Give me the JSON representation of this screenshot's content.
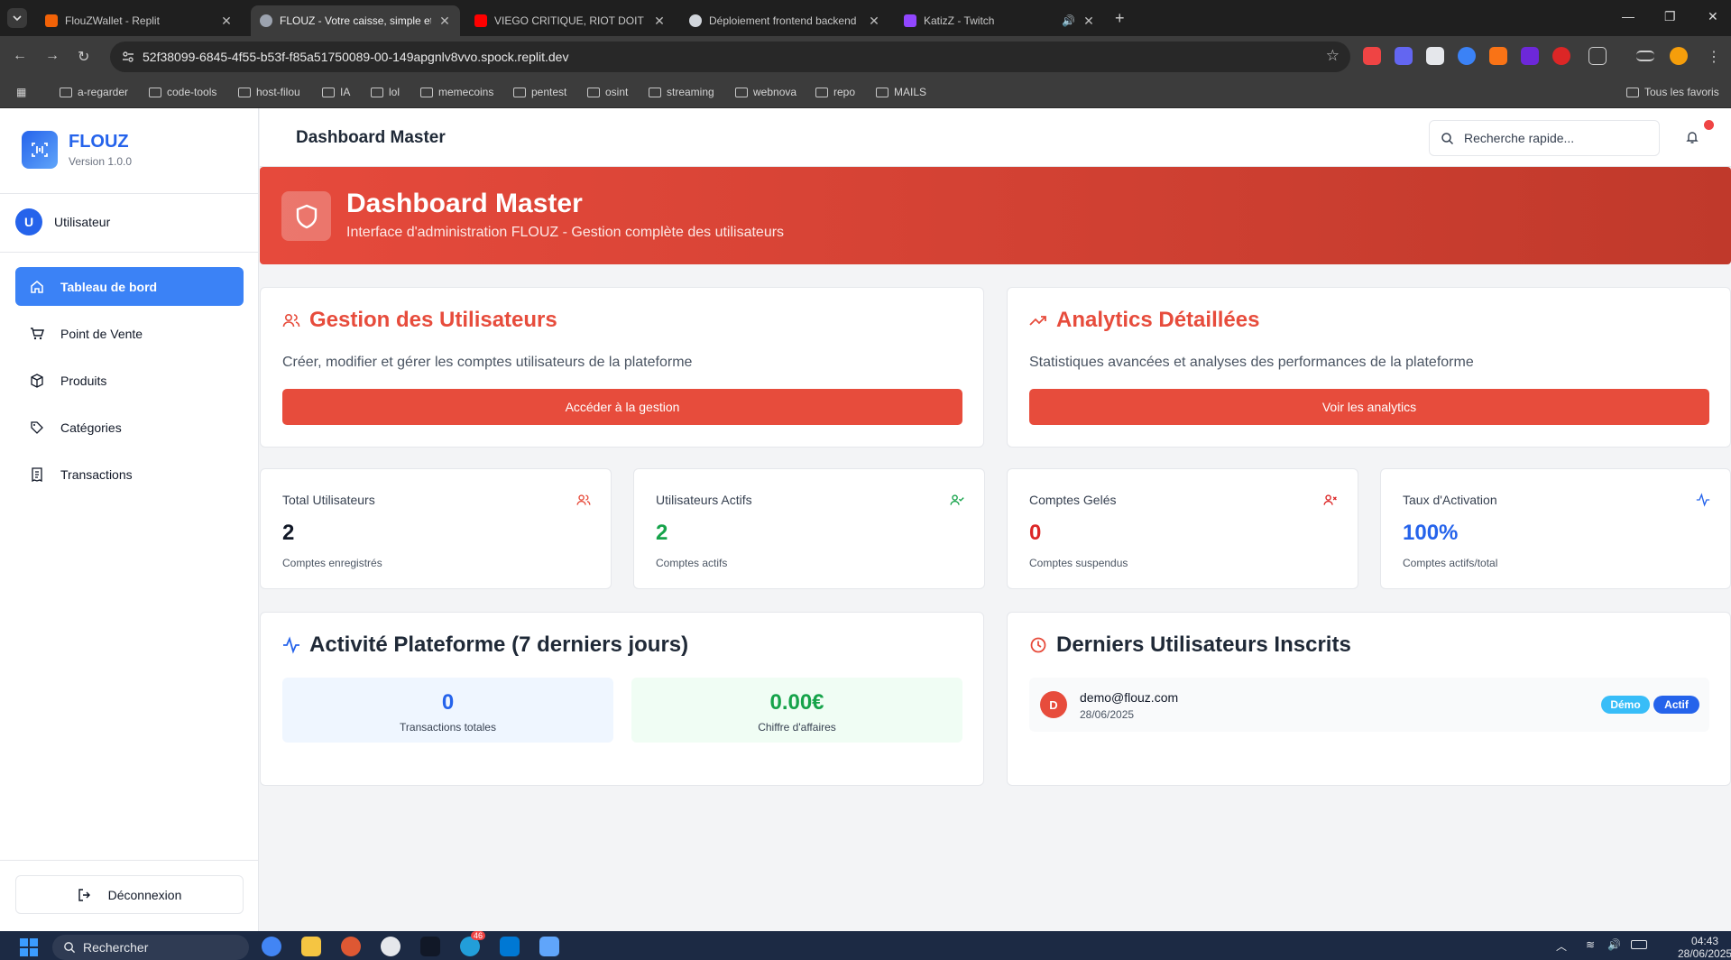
{
  "browser": {
    "tabs": [
      {
        "title": "FlouZWallet - Replit",
        "favicon_color": "#f26207"
      },
      {
        "title": "FLOUZ - Votre caisse, simple et",
        "favicon_color": "#9ca3af"
      },
      {
        "title": "VIEGO CRITIQUE, RIOT DOIT LE",
        "favicon_color": "#ff0000"
      },
      {
        "title": "Déploiement frontend backend",
        "favicon_color": "#d1d5db"
      },
      {
        "title": "KatizZ - Twitch",
        "favicon_color": "#9146ff"
      }
    ],
    "url": "52f38099-6845-4f55-b53f-f85a51750089-00-149apgnlv8vvo.spock.replit.dev",
    "bookmarks": [
      "a-regarder",
      "code-tools",
      "host-filou",
      "IA",
      "lol",
      "memecoins",
      "pentest",
      "osint",
      "streaming",
      "webnova",
      "repo",
      "MAILS"
    ],
    "all_bookmarks": "Tous les favoris"
  },
  "sidebar": {
    "brand": "FLOUZ",
    "version": "Version 1.0.0",
    "user_initial": "U",
    "user_name": "Utilisateur",
    "items": [
      {
        "label": "Tableau de bord",
        "icon": "home-icon"
      },
      {
        "label": "Point de Vente",
        "icon": "cart-icon"
      },
      {
        "label": "Produits",
        "icon": "package-icon"
      },
      {
        "label": "Catégories",
        "icon": "tag-icon"
      },
      {
        "label": "Transactions",
        "icon": "receipt-icon"
      }
    ],
    "logout": "Déconnexion"
  },
  "topbar": {
    "title": "Dashboard Master",
    "search_placeholder": "Recherche rapide..."
  },
  "hero": {
    "title": "Dashboard Master",
    "subtitle": "Interface d'administration FLOUZ - Gestion complète des utilisateurs"
  },
  "cards": {
    "users": {
      "title": "Gestion des Utilisateurs",
      "desc": "Créer, modifier et gérer les comptes utilisateurs de la plateforme",
      "button": "Accéder à la gestion"
    },
    "analytics": {
      "title": "Analytics Détaillées",
      "desc": "Statistiques avancées et analyses des performances de la plateforme",
      "button": "Voir les analytics"
    }
  },
  "stats": [
    {
      "label": "Total Utilisateurs",
      "value": "2",
      "sub": "Comptes enregistrés",
      "color": "#111827",
      "icon": "users-icon"
    },
    {
      "label": "Utilisateurs Actifs",
      "value": "2",
      "sub": "Comptes actifs",
      "color": "#16a34a",
      "icon": "user-check-icon"
    },
    {
      "label": "Comptes Gelés",
      "value": "0",
      "sub": "Comptes suspendus",
      "color": "#dc2626",
      "icon": "user-x-icon"
    },
    {
      "label": "Taux d'Activation",
      "value": "100%",
      "sub": "Comptes actifs/total",
      "color": "#2563eb",
      "icon": "activity-icon"
    }
  ],
  "activity": {
    "title": "Activité Plateforme (7 derniers jours)",
    "transactions_value": "0",
    "transactions_label": "Transactions totales",
    "revenue_value": "0.00€",
    "revenue_label": "Chiffre d'affaires"
  },
  "recent": {
    "title": "Derniers Utilisateurs Inscrits",
    "user_initial": "D",
    "email": "demo@flouz.com",
    "date": "28/06/2025",
    "badge_demo": "Démo",
    "badge_active": "Actif"
  },
  "taskbar": {
    "search": "Rechercher",
    "time": "04:43",
    "date": "28/06/2025",
    "telegram_badge": "46"
  },
  "colors": {
    "accent_red": "#e74c3c",
    "accent_blue": "#3b82f6"
  }
}
